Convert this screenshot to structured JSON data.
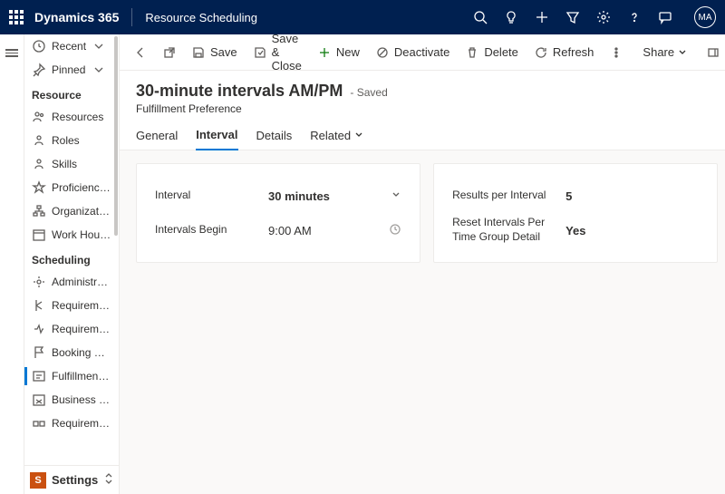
{
  "topbar": {
    "brand": "Dynamics 365",
    "app": "Resource Scheduling",
    "avatar": "MA"
  },
  "nav": {
    "recent": "Recent",
    "pinned": "Pinned",
    "groups": [
      {
        "header": "Resource",
        "items": [
          "Resources",
          "Roles",
          "Skills",
          "Proficiency Models",
          "Organizational Un…",
          "Work Hours Temp…"
        ]
      },
      {
        "header": "Scheduling",
        "items": [
          "Administration",
          "Requirement Prior…",
          "Requirement Stat…",
          "Booking Statuses",
          "Fulfillment Prefer…",
          "Business Closures",
          "Requirement Gro…"
        ]
      }
    ],
    "footer": "Settings"
  },
  "cmdbar": {
    "save": "Save",
    "saveclose": "Save & Close",
    "new": "New",
    "deactivate": "Deactivate",
    "delete": "Delete",
    "refresh": "Refresh",
    "share": "Share"
  },
  "record": {
    "title": "30-minute intervals AM/PM",
    "state": "- Saved",
    "entity": "Fulfillment Preference"
  },
  "tabs": {
    "general": "General",
    "interval": "Interval",
    "details": "Details",
    "related": "Related"
  },
  "fields": {
    "interval_label": "Interval",
    "interval_value": "30 minutes",
    "begin_label": "Intervals Begin",
    "begin_value": "9:00 AM",
    "results_label": "Results per Interval",
    "results_value": "5",
    "reset_label": "Reset Intervals Per Time Group Detail",
    "reset_value": "Yes"
  }
}
